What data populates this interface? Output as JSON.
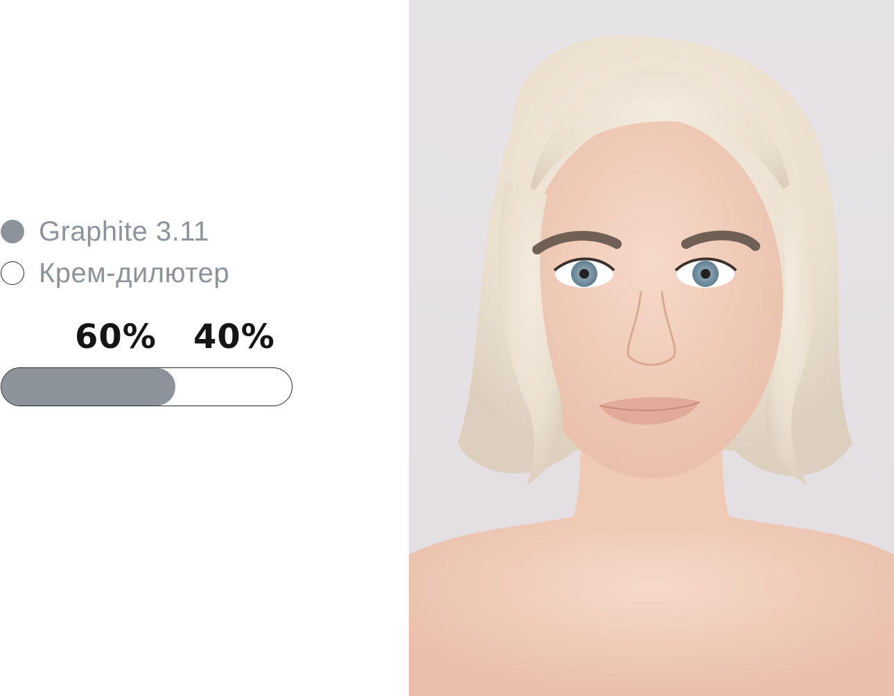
{
  "legend": {
    "items": [
      {
        "label": "Graphite 3.11",
        "style": "filled",
        "color": "#8d939b"
      },
      {
        "label": "Крем-дилютер",
        "style": "outline",
        "color": "#ffffff"
      }
    ]
  },
  "ratio": {
    "left_label": "60%",
    "right_label": "40%",
    "left_fraction": 0.6,
    "fill_color": "#8d939b"
  },
  "photo": {
    "subject": "portrait-photo"
  }
}
